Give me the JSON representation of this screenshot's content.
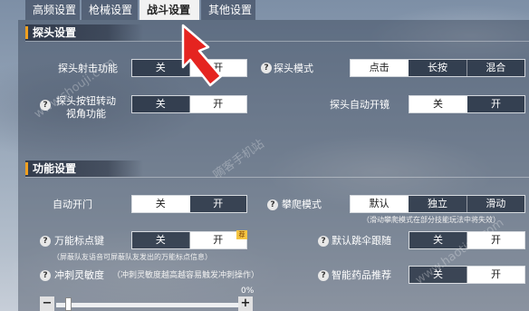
{
  "tabs": [
    "高频设置",
    "枪械设置",
    "战斗设置",
    "其他设置"
  ],
  "active_tab": 2,
  "sections": {
    "peek": {
      "title": "探头设置",
      "peek_shoot_label": "探头射击功能",
      "peek_shoot_options": [
        "关",
        "开"
      ],
      "peek_mode_label": "探头模式",
      "peek_mode_options": [
        "点击",
        "长按",
        "混合"
      ],
      "peek_rotate_label_1": "探头按钮转动",
      "peek_rotate_label_2": "视角功能",
      "peek_rotate_options": [
        "关",
        "开"
      ],
      "peek_auto_scope_label": "探头自动开镜",
      "peek_auto_scope_options": [
        "关",
        "开"
      ]
    },
    "function": {
      "title": "功能设置",
      "auto_door_label": "自动开门",
      "auto_door_options": [
        "关",
        "开"
      ],
      "climb_mode_label": "攀爬模式",
      "climb_mode_options": [
        "默认",
        "独立",
        "滑动"
      ],
      "climb_note": "（滑动攀爬模式在部分技能玩法中将失效）",
      "universal_mark_label": "万能标点键",
      "universal_mark_options": [
        "关",
        "开"
      ],
      "universal_mark_badge": "荐",
      "universal_mark_note": "（屏蔽队友语音可屏蔽队友发出的万能标点信息）",
      "default_parachute_label": "默认跳伞跟随",
      "default_parachute_options": [
        "关",
        "开"
      ],
      "sprint_sensitivity_label": "冲刺灵敏度",
      "sprint_sensitivity_note": "（冲刺灵敏度越高越容易触发冲刺操作）",
      "smart_medicine_label": "智能药品推荐",
      "smart_medicine_options": [
        "关",
        "开"
      ],
      "sprint_sensitivity_value": "0%",
      "sprint_sensitivity_level": 0.0
    }
  },
  "help_mark": "?",
  "slider_minus": "−",
  "slider_plus": "+",
  "watermarks": [
    "www.shouji.com",
    "嘀客手机站",
    "www.haotiao.com"
  ],
  "colors": {
    "highlight_arrow": "#e52420",
    "section_accent": "#f0a020"
  }
}
